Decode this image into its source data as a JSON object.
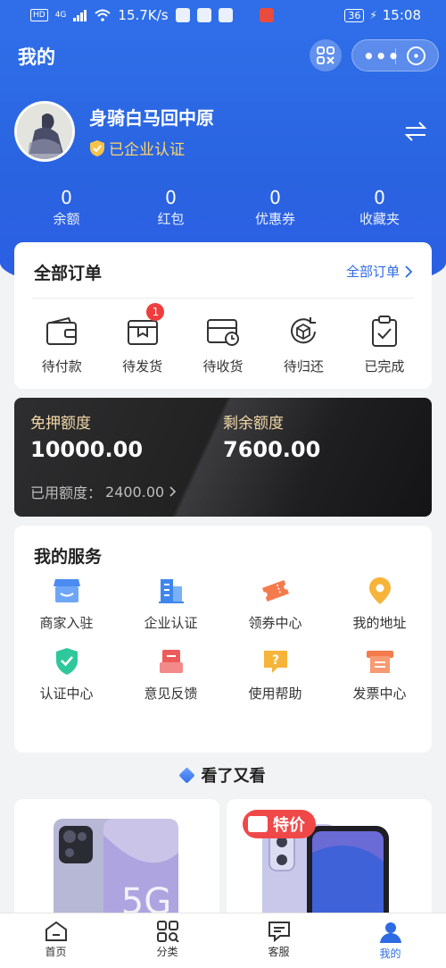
{
  "status_bar": {
    "network": "HD",
    "signal": "4G",
    "speed": "15.7K/s",
    "battery": "36",
    "time": "15:08"
  },
  "header": {
    "title": "我的"
  },
  "user": {
    "name": "身骑白马回中原",
    "verified_text": "已企业认证"
  },
  "stats": [
    {
      "value": "0",
      "label": "余额"
    },
    {
      "value": "0",
      "label": "红包"
    },
    {
      "value": "0",
      "label": "优惠券"
    },
    {
      "value": "0",
      "label": "收藏夹"
    }
  ],
  "orders": {
    "title": "全部订单",
    "all_link": "全部订单",
    "items": [
      {
        "label": "待付款",
        "icon": "wallet-icon"
      },
      {
        "label": "待发货",
        "icon": "box-icon",
        "badge": "1"
      },
      {
        "label": "待收货",
        "icon": "card-clock-icon"
      },
      {
        "label": "待归还",
        "icon": "return-box-icon"
      },
      {
        "label": "已完成",
        "icon": "clipboard-check-icon"
      }
    ]
  },
  "credit": {
    "deposit_free_label": "免押额度",
    "deposit_free_value": "10000.00",
    "remaining_label": "剩余额度",
    "remaining_value": "7600.00",
    "used_label": "已用额度：",
    "used_value": "2400.00"
  },
  "services": {
    "title": "我的服务",
    "items": [
      {
        "label": "商家入驻",
        "icon": "shop-icon",
        "color": "#4a8cf0"
      },
      {
        "label": "企业认证",
        "icon": "building-icon",
        "color": "#3f86ee"
      },
      {
        "label": "领券中心",
        "icon": "ticket-icon",
        "color": "#f57a4c"
      },
      {
        "label": "我的地址",
        "icon": "location-pin-icon",
        "color": "#f6b43a"
      },
      {
        "label": "认证中心",
        "icon": "shield-check-icon",
        "color": "#2fc79c"
      },
      {
        "label": "意见反馈",
        "icon": "feedback-icon",
        "color": "#ee5b5b"
      },
      {
        "label": "使用帮助",
        "icon": "help-icon",
        "color": "#f6b43a"
      },
      {
        "label": "发票中心",
        "icon": "invoice-icon",
        "color": "#f57a4c"
      }
    ]
  },
  "recommend": {
    "title": "看了又看",
    "special_tag": "特价",
    "product1_text": "5G"
  },
  "tabbar": [
    {
      "label": "首页",
      "icon": "home-icon"
    },
    {
      "label": "分类",
      "icon": "category-icon"
    },
    {
      "label": "客服",
      "icon": "chat-icon"
    },
    {
      "label": "我的",
      "icon": "user-icon",
      "active": true
    }
  ],
  "colors": {
    "primary": "#2f6ee8",
    "gold": "#ffd66b",
    "badge_red": "#ee3d3d"
  }
}
